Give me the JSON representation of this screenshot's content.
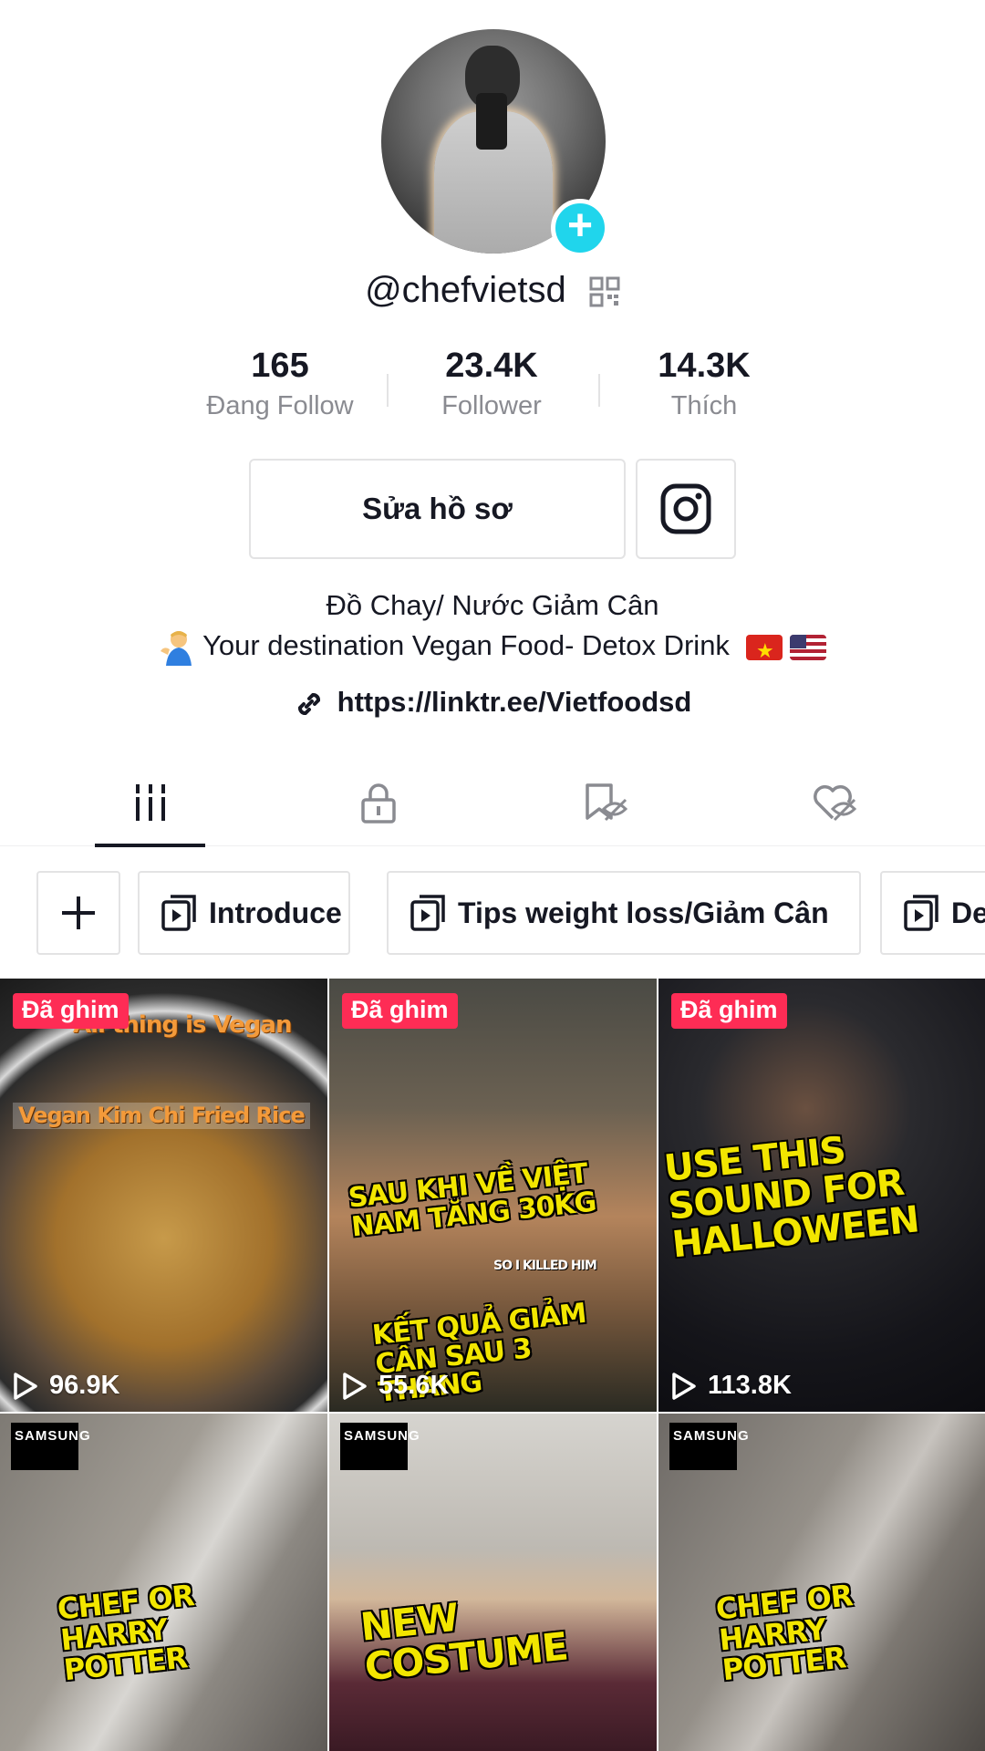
{
  "profile": {
    "username": "@chefvietsd",
    "stats": [
      {
        "value": "165",
        "label": "Đang Follow"
      },
      {
        "value": "23.4K",
        "label": "Follower"
      },
      {
        "value": "14.3K",
        "label": "Thích"
      }
    ],
    "edit_button": "Sửa hồ sơ",
    "bio_line1": "Đồ Chay/ Nước Giảm Cân",
    "bio_line2": "Your destination Vegan Food- Detox Drink",
    "link": "https://linktr.ee/Vietfoodsd"
  },
  "tabs": [
    {
      "name": "videos",
      "icon": "grid-icon",
      "active": true
    },
    {
      "name": "private",
      "icon": "lock-icon",
      "active": false
    },
    {
      "name": "reposts",
      "icon": "hidden-bookmark-icon",
      "active": false
    },
    {
      "name": "liked",
      "icon": "hidden-heart-icon",
      "active": false
    }
  ],
  "playlists": {
    "add_label": "+",
    "items": [
      "Introduce",
      "Tips weight loss/Giảm Cân",
      "De"
    ]
  },
  "videos": [
    {
      "pinned_label": "Đã ghim",
      "views": "96.9K",
      "captions": [
        "All thing is Vegan",
        "Vegan Kim Chi Fried Rice"
      ]
    },
    {
      "pinned_label": "Đã ghim",
      "views": "55.6K",
      "captions": [
        "SAU KHI VỀ VIỆT NAM TĂNG 30KG",
        "SO I KILLED HIM",
        "KẾT QUẢ GIẢM CÂN SAU 3 THÁNG"
      ]
    },
    {
      "pinned_label": "Đã ghim",
      "views": "113.8K",
      "captions": [
        "USE THIS SOUND FOR HALLOWEEN"
      ]
    },
    {
      "brand": "SAMSUNG",
      "captions": [
        "CHEF OR HARRY POTTER"
      ]
    },
    {
      "brand": "SAMSUNG",
      "captions": [
        "NEW COSTUME"
      ]
    },
    {
      "brand": "SAMSUNG",
      "captions": [
        "CHEF OR HARRY POTTER"
      ]
    }
  ],
  "colors": {
    "accent_pink": "#fe2c55",
    "accent_cyan": "#20d5ec",
    "text_primary": "#161823",
    "text_secondary": "#8a8b91"
  }
}
